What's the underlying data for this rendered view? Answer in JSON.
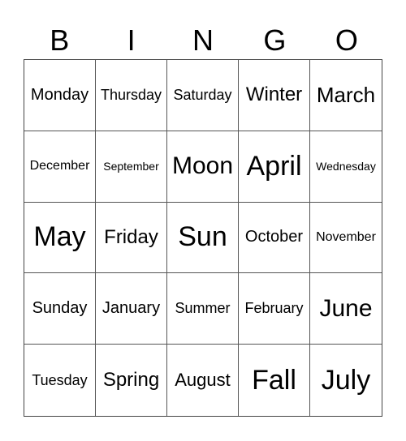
{
  "header": [
    "B",
    "I",
    "N",
    "G",
    "O"
  ],
  "cells": [
    "Monday",
    "Thursday",
    "Saturday",
    "Winter",
    "March",
    "December",
    "September",
    "Moon",
    "April",
    "Wednesday",
    "May",
    "Friday",
    "Sun",
    "October",
    "November",
    "Sunday",
    "January",
    "Summer",
    "February",
    "June",
    "Tuesday",
    "Spring",
    "August",
    "Fall",
    "July"
  ]
}
